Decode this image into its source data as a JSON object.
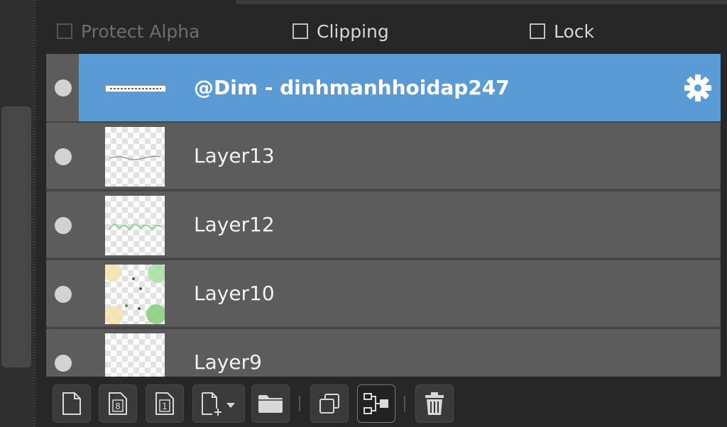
{
  "options": {
    "protect_alpha": {
      "label": "Protect Alpha",
      "checked": false,
      "enabled": false
    },
    "clipping": {
      "label": "Clipping",
      "checked": false,
      "enabled": true
    },
    "lock": {
      "label": "Lock",
      "checked": false,
      "enabled": true
    }
  },
  "layers": [
    {
      "name": "@Dim - dinhmanhhoidap247",
      "selected": true,
      "visible": true,
      "type": "text",
      "has_settings_icon": true
    },
    {
      "name": "Layer13",
      "selected": false,
      "visible": true,
      "type": "raster"
    },
    {
      "name": "Layer12",
      "selected": false,
      "visible": true,
      "type": "raster"
    },
    {
      "name": "Layer10",
      "selected": false,
      "visible": true,
      "type": "raster"
    },
    {
      "name": "Layer9",
      "selected": false,
      "visible": true,
      "type": "raster"
    }
  ],
  "toolbar": {
    "buttons": [
      {
        "id": "new-layer",
        "icon": "page-icon"
      },
      {
        "id": "new-8bit-layer",
        "icon": "page-8-icon",
        "glyph": "8"
      },
      {
        "id": "new-1bit-layer",
        "icon": "page-1-icon",
        "glyph": "1"
      },
      {
        "id": "add-layer-menu",
        "icon": "page-plus-dropdown-icon"
      },
      {
        "id": "new-folder",
        "icon": "folder-icon"
      },
      {
        "id": "duplicate-layer",
        "icon": "duplicate-icon"
      },
      {
        "id": "merge-down",
        "icon": "merge-icon"
      },
      {
        "id": "delete-layer",
        "icon": "trash-icon"
      }
    ]
  },
  "colors": {
    "selection": "#5b9bd5",
    "row_bg": "#5c5c5c",
    "panel_bg": "#272727"
  }
}
